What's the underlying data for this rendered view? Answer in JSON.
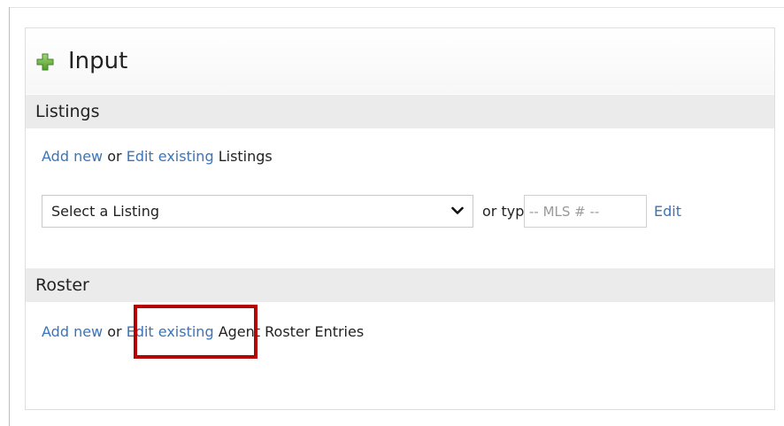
{
  "panel": {
    "title": "Input",
    "icon": "plus-icon",
    "accent_color": "#6ab04c"
  },
  "listings": {
    "section_title": "Listings",
    "add_new_label": "Add new",
    "or_text": "or",
    "edit_existing_label": "Edit existing",
    "suffix_text": "Listings",
    "select_value": "Select a Listing",
    "or_type_label": "or type",
    "mls_placeholder": "-- MLS # --",
    "edit_label": "Edit"
  },
  "roster": {
    "section_title": "Roster",
    "add_new_label": "Add new",
    "or_text": "or",
    "edit_existing_label": "Edit existing",
    "suffix_text": "Agent Roster Entries"
  },
  "colors": {
    "link": "#3a74b9",
    "highlight_box": "#b40000",
    "section_bar": "#ebebeb"
  }
}
